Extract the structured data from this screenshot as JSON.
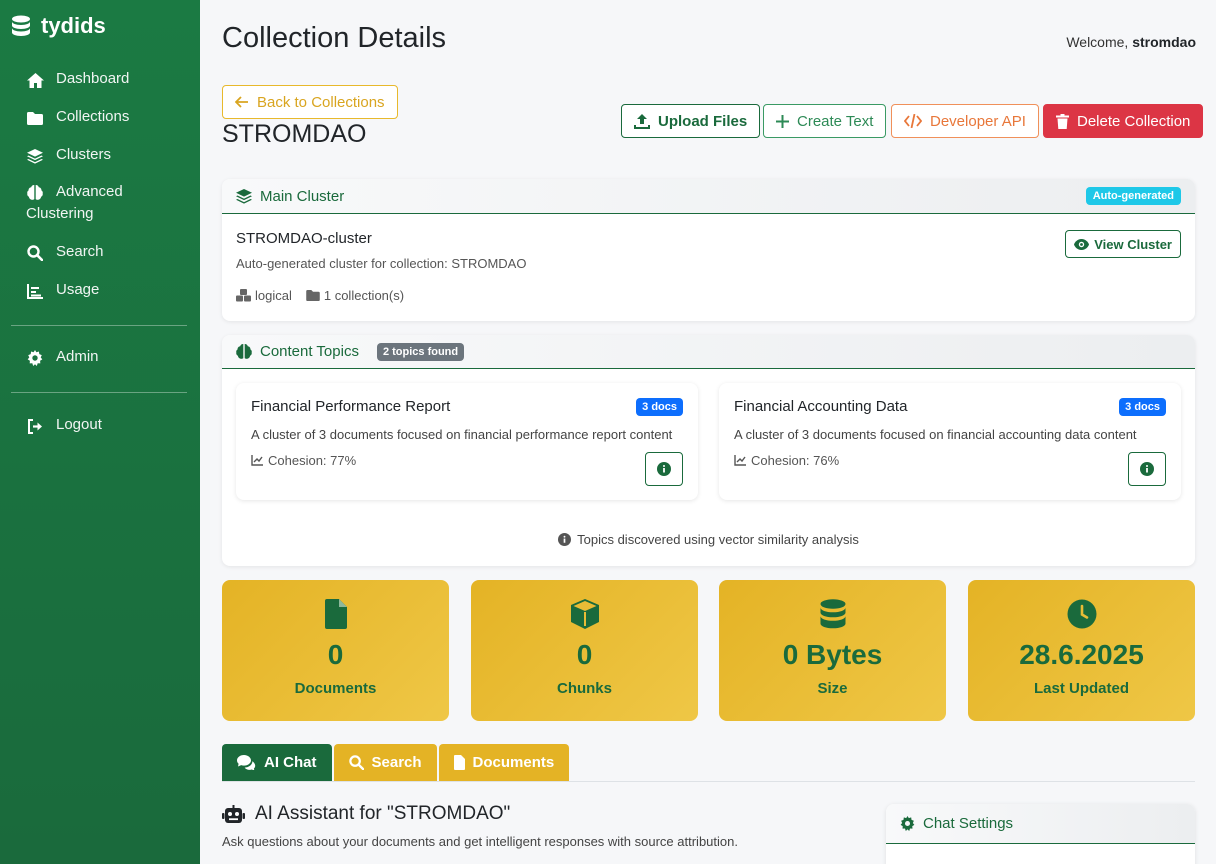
{
  "brand": {
    "name": "tydids",
    "icon": "database-icon"
  },
  "sidebar": {
    "items": [
      {
        "label": "Dashboard",
        "icon": "home-icon"
      },
      {
        "label": "Collections",
        "icon": "folder-icon"
      },
      {
        "label": "Clusters",
        "icon": "layers-icon"
      },
      {
        "label_line1": "Advanced",
        "label_line2": "Clustering",
        "icon": "brain-icon"
      },
      {
        "label": "Search",
        "icon": "search-icon"
      },
      {
        "label": "Usage",
        "icon": "chart-icon"
      },
      {
        "label": "Admin",
        "icon": "gear-icon"
      },
      {
        "label": "Logout",
        "icon": "logout-icon"
      }
    ]
  },
  "header": {
    "title": "Collection Details",
    "welcome_prefix": "Welcome,",
    "username": "stromdao"
  },
  "actions": {
    "back": "Back to Collections",
    "upload": "Upload Files",
    "create": "Create Text",
    "developer": "Developer API",
    "delete": "Delete Collection"
  },
  "collection": {
    "name": "STROMDAO"
  },
  "main_cluster": {
    "heading": "Main Cluster",
    "badge": "Auto-generated",
    "name": "STROMDAO-cluster",
    "description": "Auto-generated cluster for collection: STROMDAO",
    "type": "logical",
    "collections": "1 collection(s)",
    "view_button": "View Cluster"
  },
  "content_topics": {
    "heading": "Content Topics",
    "badge": "2 topics found",
    "topics": [
      {
        "title": "Financial Performance Report",
        "docs": "3 docs",
        "description": "A cluster of 3 documents focused on financial performance report content",
        "cohesion": "Cohesion: 77%"
      },
      {
        "title": "Financial Accounting Data",
        "docs": "3 docs",
        "description": "A cluster of 3 documents focused on financial accounting data content",
        "cohesion": "Cohesion: 76%"
      }
    ],
    "note": "Topics discovered using vector similarity analysis"
  },
  "stats": [
    {
      "value": "0",
      "label": "Documents",
      "icon": "file-icon"
    },
    {
      "value": "0",
      "label": "Chunks",
      "icon": "cube-icon"
    },
    {
      "value": "0 Bytes",
      "label": "Size",
      "icon": "database-icon"
    },
    {
      "value": "28.6.2025",
      "label": "Last Updated",
      "icon": "clock-icon"
    }
  ],
  "tabs": [
    {
      "label": "AI Chat",
      "icon": "comments-icon",
      "active": true
    },
    {
      "label": "Search",
      "icon": "search-icon",
      "active": false
    },
    {
      "label": "Documents",
      "icon": "file-icon",
      "active": false
    }
  ],
  "ai": {
    "title": "AI Assistant for \"STROMDAO\"",
    "subtitle": "Ask questions about your documents and get intelligent responses with source attribution."
  },
  "chat_settings": {
    "heading": "Chat Settings"
  },
  "colors": {
    "primary_green": "#1a6a3c",
    "accent_yellow": "#e4b325",
    "danger": "#dc3545",
    "info_cyan": "#1ec8e8",
    "badge_blue": "#0d6efd"
  }
}
